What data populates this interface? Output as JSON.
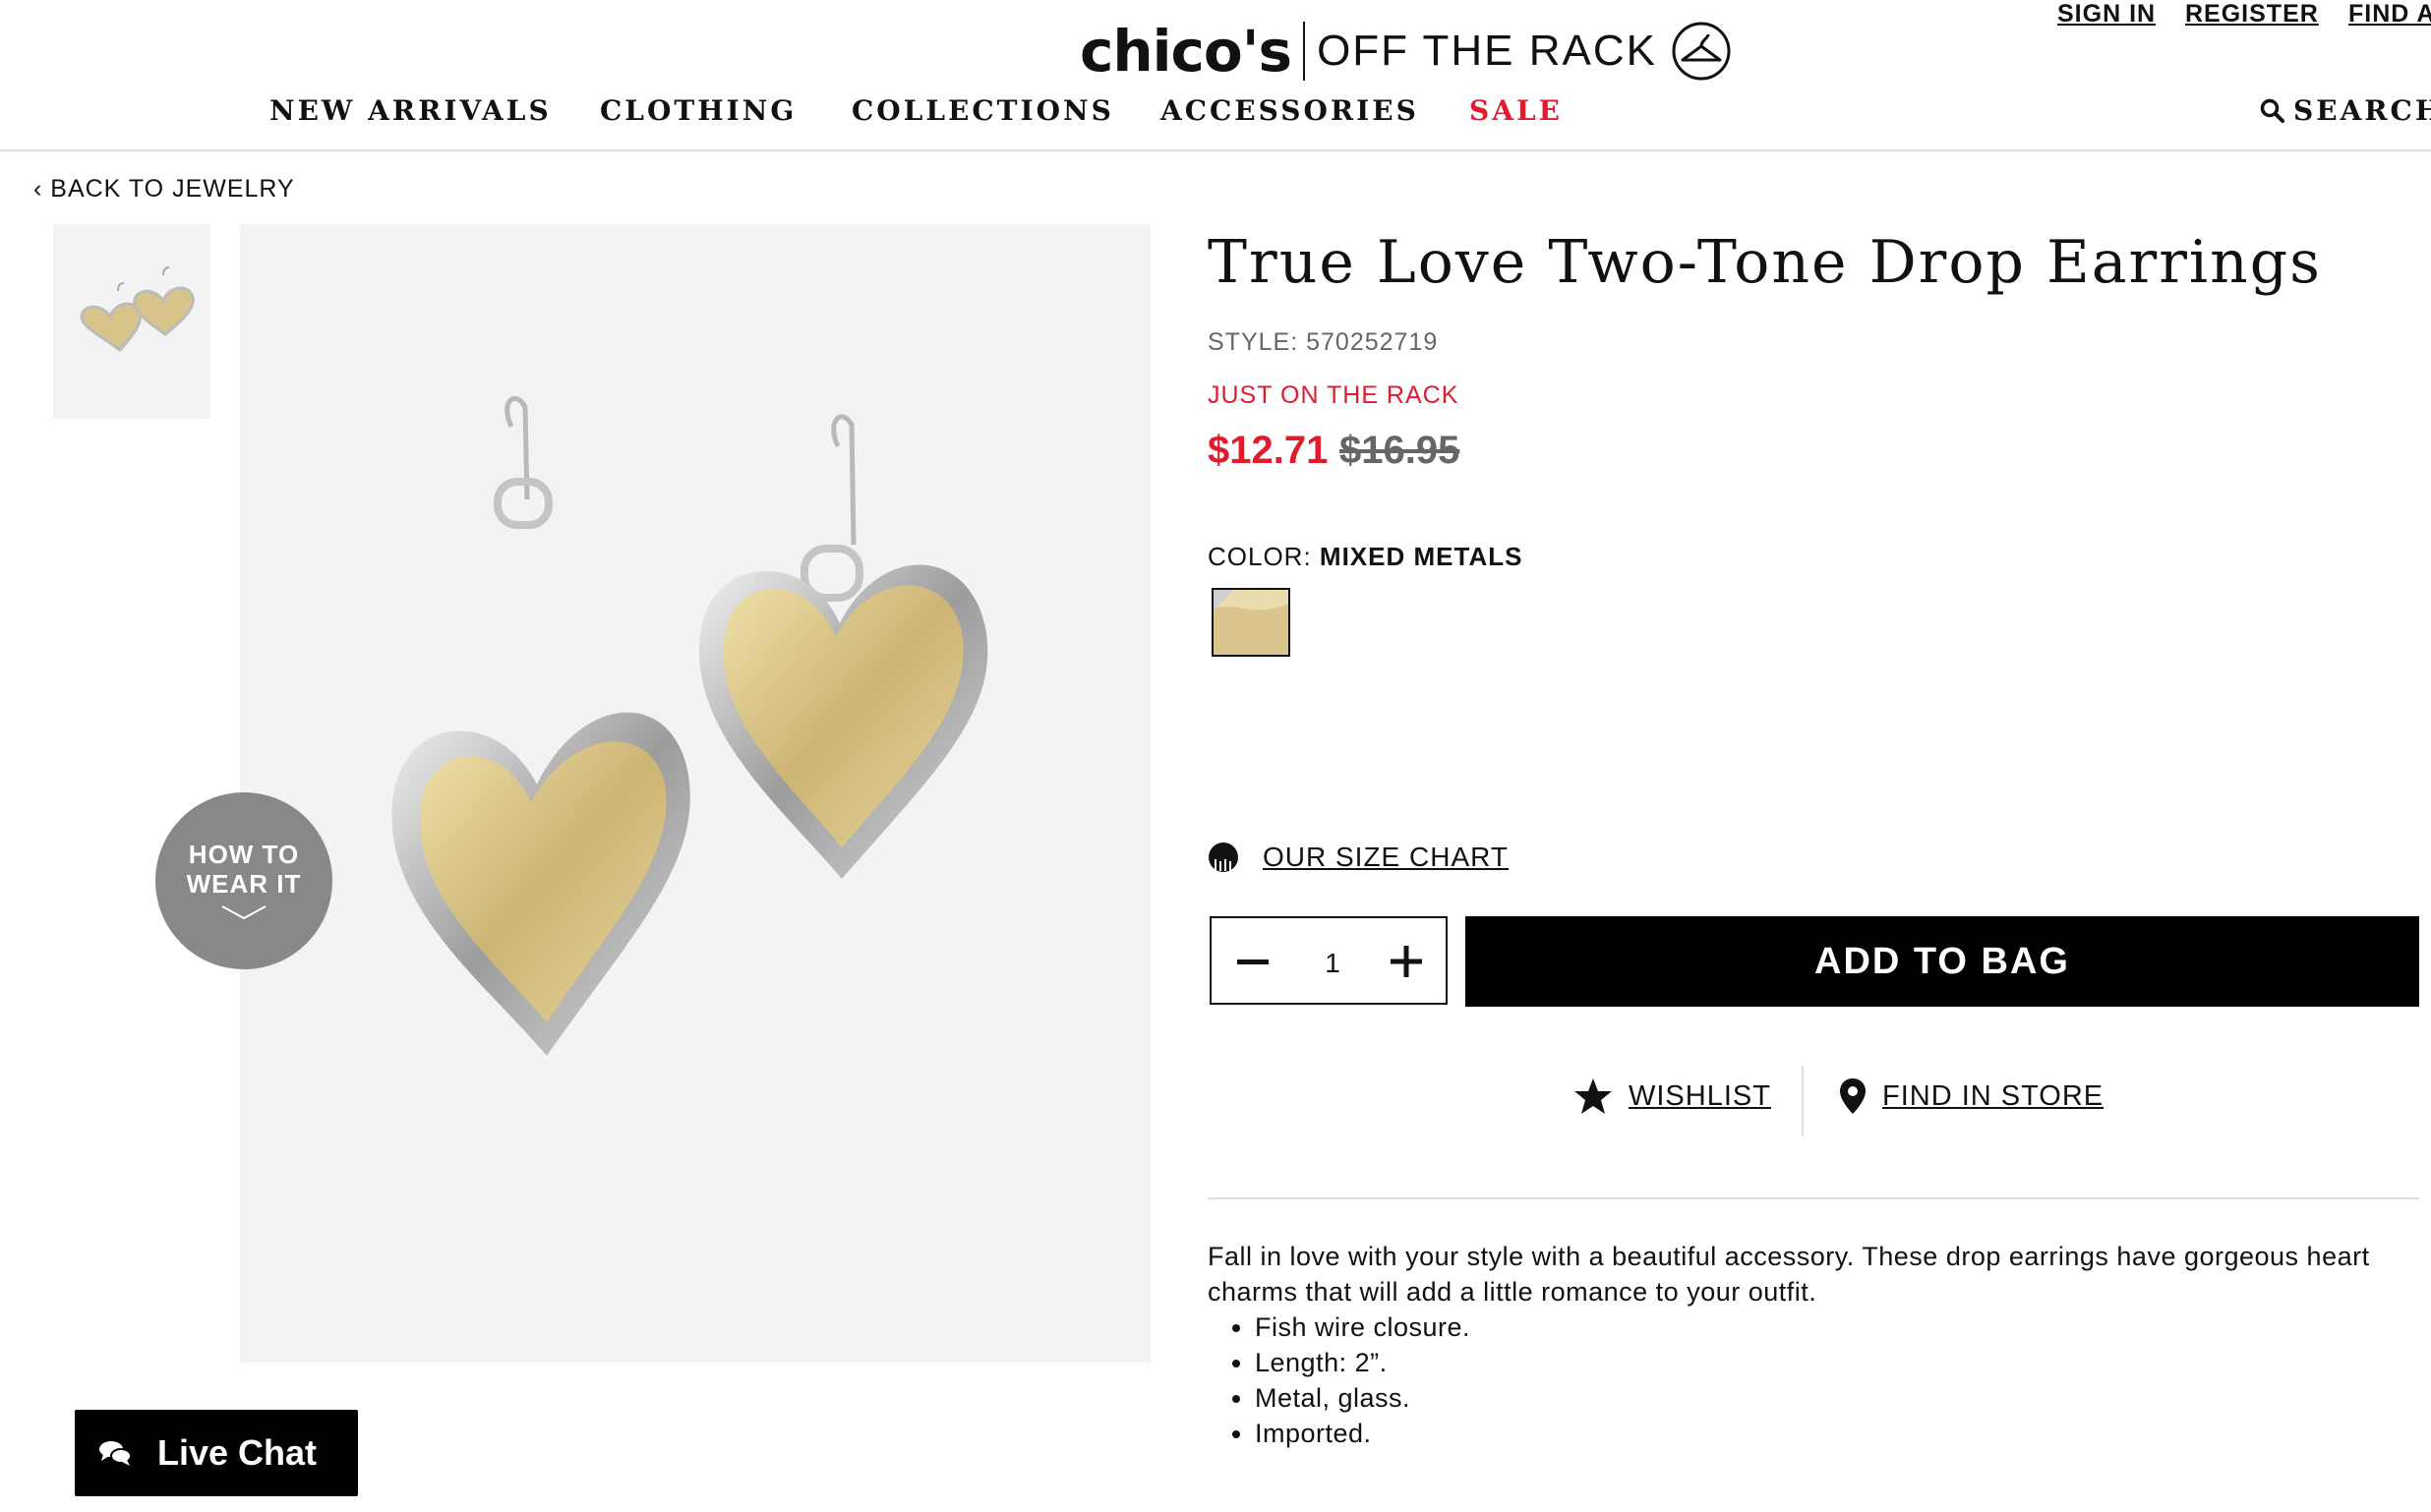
{
  "utility": {
    "sign_in": "SIGN IN",
    "register": "REGISTER",
    "find": "FIND A"
  },
  "logo": {
    "brand": "chico's",
    "sub": "OFF THE RACK"
  },
  "nav": {
    "items": [
      "NEW ARRIVALS",
      "CLOTHING",
      "COLLECTIONS",
      "ACCESSORIES",
      "SALE"
    ],
    "search_label": "SEARCH"
  },
  "breadcrumb": {
    "back": "BACK TO JEWELRY"
  },
  "gallery": {
    "how_to_wear": "HOW TO WEAR IT"
  },
  "product": {
    "title": "True Love Two-Tone Drop Earrings",
    "style_label": "STYLE:",
    "style_number": "570252719",
    "badge": "JUST ON THE RACK",
    "price": "$12.71",
    "original_price": "$16.95",
    "color_label": "COLOR:",
    "color_value": "MIXED METALS",
    "size_chart": "OUR SIZE CHART",
    "quantity": "1",
    "add_to_bag": "ADD TO BAG",
    "wishlist": "WISHLIST",
    "find_in_store": "FIND IN STORE",
    "description": "Fall in love with your style with a beautiful accessory. These drop earrings have gorgeous heart charms that will add a little romance to your outfit.",
    "bullets": [
      "Fish wire closure.",
      "Length: 2”.",
      "Metal, glass.",
      "Imported."
    ]
  },
  "chat": {
    "label": "Live Chat"
  },
  "colors": {
    "sale": "#e01b2e",
    "button": "#000000",
    "muted": "#666666"
  }
}
